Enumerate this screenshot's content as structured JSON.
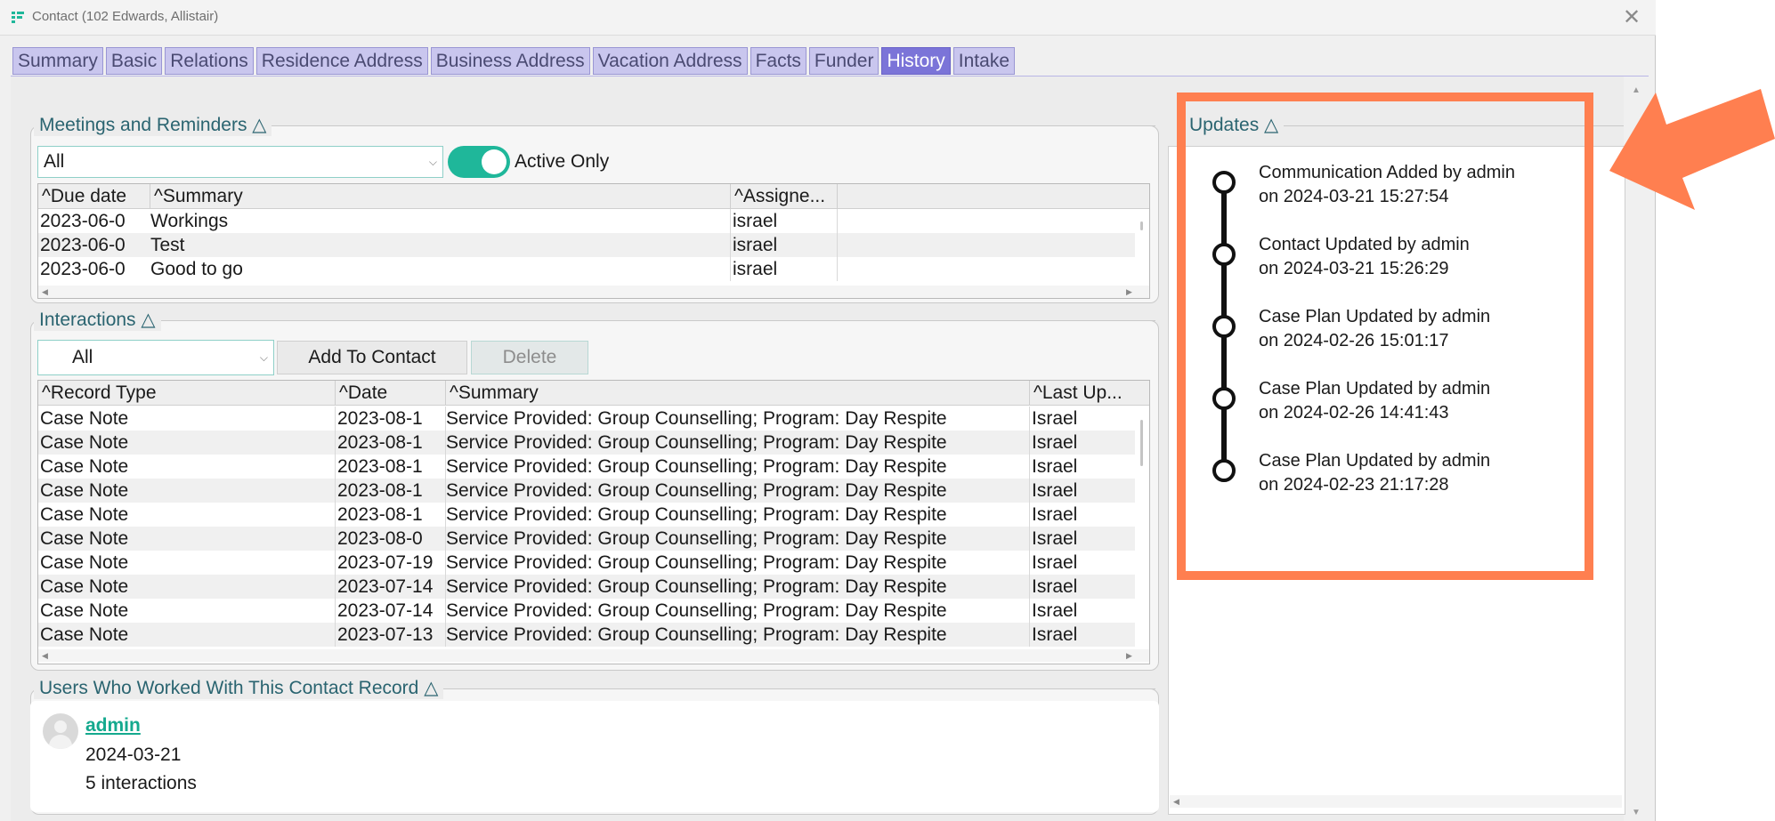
{
  "window": {
    "title": "Contact (102   Edwards, Allistair)",
    "close_symbol": "✕"
  },
  "tabs": [
    {
      "label": "Summary",
      "active": false
    },
    {
      "label": "Basic",
      "active": false
    },
    {
      "label": "Relations",
      "active": false
    },
    {
      "label": "Residence Address",
      "active": false
    },
    {
      "label": "Business Address",
      "active": false
    },
    {
      "label": "Vacation Address",
      "active": false
    },
    {
      "label": "Facts",
      "active": false
    },
    {
      "label": "Funder",
      "active": false
    },
    {
      "label": "History",
      "active": true
    },
    {
      "label": "Intake",
      "active": false
    }
  ],
  "meetings": {
    "title": "Meetings and Reminders △",
    "filter_value": "All",
    "active_only_label": "Active Only",
    "active_only_on": true,
    "columns": [
      "^Due date",
      "^Summary",
      "^Assigne..."
    ],
    "rows": [
      {
        "due": "2023-06-0",
        "summary": "Workings",
        "assignee": "israel"
      },
      {
        "due": "2023-06-0",
        "summary": "Test",
        "assignee": "israel"
      },
      {
        "due": "2023-06-0",
        "summary": "Good to go",
        "assignee": "israel"
      }
    ]
  },
  "interactions": {
    "title": "Interactions △",
    "filter_value": "All",
    "add_button": "Add To Contact",
    "delete_button": "Delete",
    "columns": [
      "^Record Type",
      "^Date",
      "^Summary",
      "^Last Up..."
    ],
    "rows": [
      {
        "type": "Case Note",
        "date": "2023-08-1",
        "summary": "Service Provided: Group Counselling; Program: Day Respite",
        "last": "Israel"
      },
      {
        "type": "Case Note",
        "date": "2023-08-1",
        "summary": "Service Provided: Group Counselling; Program: Day Respite",
        "last": "Israel"
      },
      {
        "type": "Case Note",
        "date": "2023-08-1",
        "summary": "Service Provided: Group Counselling; Program: Day Respite",
        "last": "Israel"
      },
      {
        "type": "Case Note",
        "date": "2023-08-1",
        "summary": "Service Provided: Group Counselling; Program: Day Respite",
        "last": "Israel"
      },
      {
        "type": "Case Note",
        "date": "2023-08-1",
        "summary": "Service Provided: Group Counselling; Program: Day Respite",
        "last": "Israel"
      },
      {
        "type": "Case Note",
        "date": "2023-08-0",
        "summary": "Service Provided: Group Counselling; Program: Day Respite",
        "last": "Israel"
      },
      {
        "type": "Case Note",
        "date": "2023-07-19",
        "summary": "Service Provided: Group Counselling; Program: Day Respite",
        "last": "Israel"
      },
      {
        "type": "Case Note",
        "date": "2023-07-14",
        "summary": "Service Provided: Group Counselling; Program: Day Respite",
        "last": "Israel"
      },
      {
        "type": "Case Note",
        "date": "2023-07-14",
        "summary": "Service Provided: Group Counselling; Program: Day Respite",
        "last": "Israel"
      },
      {
        "type": "Case Note",
        "date": "2023-07-13",
        "summary": "Service Provided: Group Counselling; Program: Day Respite",
        "last": "Israel"
      }
    ]
  },
  "users": {
    "title": "Users Who Worked With This Contact Record △",
    "name": "admin",
    "date": "2024-03-21",
    "interactions": "5 interactions"
  },
  "updates": {
    "title": "Updates △",
    "items": [
      {
        "line1": "Communication Added by admin",
        "line2": "on 2024-03-21 15:27:54"
      },
      {
        "line1": "Contact Updated by admin",
        "line2": "on 2024-03-21 15:26:29"
      },
      {
        "line1": "Case Plan Updated by admin",
        "line2": "on 2024-02-26 15:01:17"
      },
      {
        "line1": "Case Plan Updated by admin",
        "line2": "on 2024-02-26 14:41:43"
      },
      {
        "line1": "Case Plan Updated by admin",
        "line2": "on 2024-02-23 21:17:28"
      }
    ]
  },
  "colors": {
    "accent": "#1fb79a",
    "tab_active": "#7b74d8",
    "tab_inactive": "#c9c6ee",
    "highlight": "#ff7f50",
    "group_title": "#2a6470"
  },
  "icons": {
    "app": "app-logo-icon",
    "close": "close-icon",
    "chevron": "chevron-down-icon",
    "avatar": "user-avatar-icon",
    "annotation_arrow": "annotation-arrow-icon"
  }
}
